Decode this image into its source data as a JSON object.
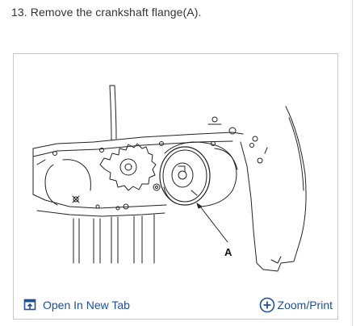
{
  "step": {
    "text": "13. Remove the crankshaft flange(A)."
  },
  "figure": {
    "callout_label": "A",
    "icons": [
      "open-tab-icon",
      "zoom-plus-icon"
    ]
  },
  "footer": {
    "open_tab_label": "Open In New Tab",
    "zoom_label": "Zoom/Print"
  },
  "colors": {
    "link": "#1e4fa0",
    "text": "#333333",
    "frame_border": "#c8c8c8"
  }
}
